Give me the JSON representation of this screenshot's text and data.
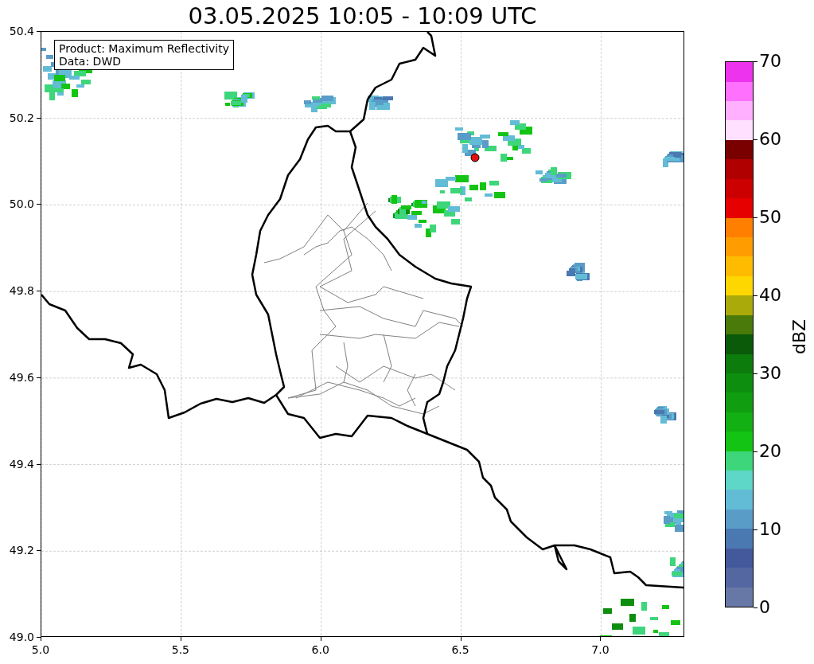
{
  "title": "03.05.2025 10:05 - 10:09 UTC",
  "info_box": [
    "Product: Maximum Reflectivity",
    "Data: DWD"
  ],
  "x_axis": {
    "ticks": [
      "5.0",
      "5.5",
      "6.0",
      "6.5",
      "7.0"
    ]
  },
  "y_axis": {
    "ticks": [
      "50.4",
      "50.2",
      "50.0",
      "49.8",
      "49.6",
      "49.4",
      "49.2",
      "49.0"
    ]
  },
  "colorbar": {
    "label": "dBZ",
    "ticks": [
      "70",
      "60",
      "50",
      "40",
      "30",
      "20",
      "10",
      "0"
    ],
    "segments": [
      {
        "color": "#6878a6"
      },
      {
        "color": "#5567a0"
      },
      {
        "color": "#44599b"
      },
      {
        "color": "#4a78b0"
      },
      {
        "color": "#5a9cc8"
      },
      {
        "color": "#62bcd6"
      },
      {
        "color": "#5ed6c8"
      },
      {
        "color": "#3ed67a"
      },
      {
        "color": "#14c414"
      },
      {
        "color": "#12b012"
      },
      {
        "color": "#109e10"
      },
      {
        "color": "#0e8e0e"
      },
      {
        "color": "#0c7c0c"
      },
      {
        "color": "#0a5a0a"
      },
      {
        "color": "#4a7a0a"
      },
      {
        "color": "#aaaa0a"
      },
      {
        "color": "#ffd700"
      },
      {
        "color": "#ffbb00"
      },
      {
        "color": "#ff9d00"
      },
      {
        "color": "#ff7f00"
      },
      {
        "color": "#e60000"
      },
      {
        "color": "#cc0000"
      },
      {
        "color": "#b00000"
      },
      {
        "color": "#7a0000"
      },
      {
        "color": "#ffe0ff"
      },
      {
        "color": "#ffb0ff"
      },
      {
        "color": "#ff70ff"
      },
      {
        "color": "#ee33ee"
      }
    ]
  }
}
